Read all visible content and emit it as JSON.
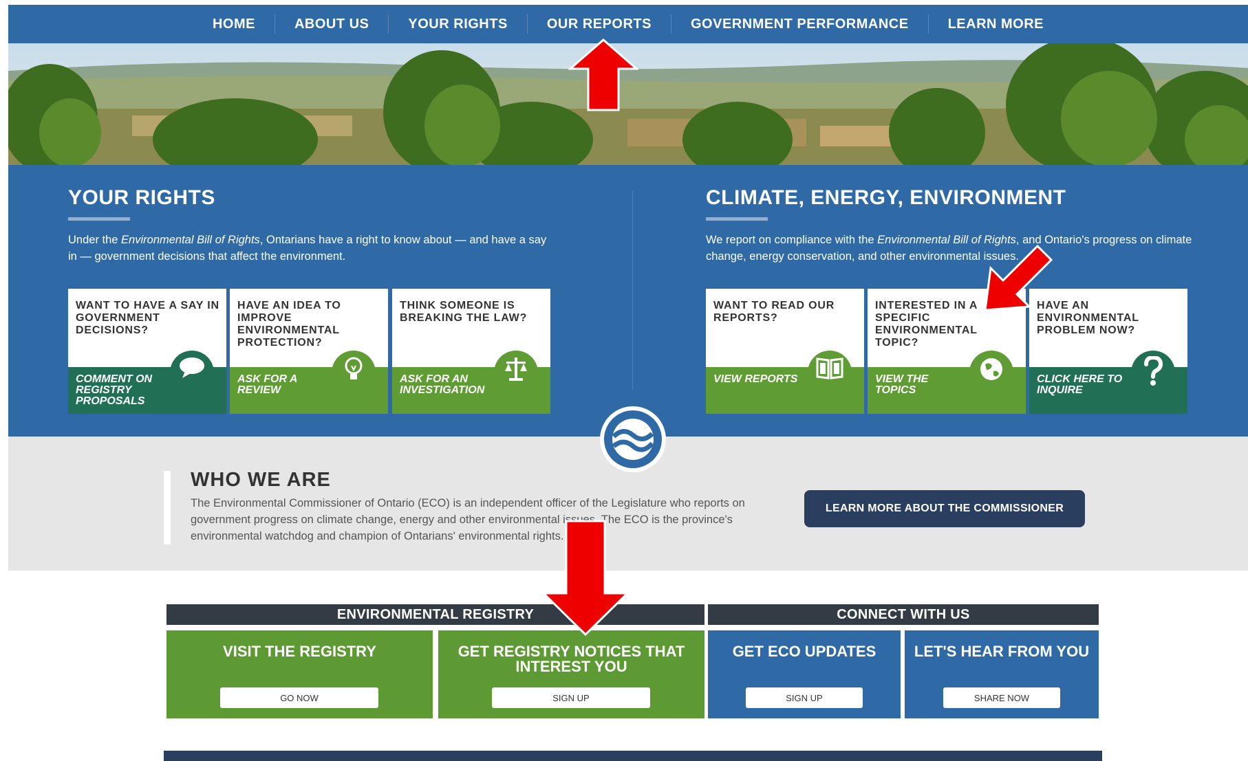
{
  "nav": {
    "items": [
      "HOME",
      "ABOUT US",
      "YOUR RIGHTS",
      "OUR REPORTS",
      "GOVERNMENT PERFORMANCE",
      "LEARN MORE"
    ]
  },
  "rights": {
    "title": "YOUR RIGHTS",
    "text_pre": "Under the ",
    "text_italic": "Environmental Bill of Rights",
    "text_post": ", Ontarians have a right to know about — and have a say in — government decisions that affect the environment.",
    "cards": [
      {
        "question": "WANT TO HAVE A SAY IN GOVERNMENT DECISIONS?",
        "link": "COMMENT ON REGISTRY PROPOSALS",
        "icon": "speech-bubble-icon"
      },
      {
        "question": "HAVE AN IDEA TO IMPROVE ENVIRONMENTAL PROTECTION?",
        "link": "ASK FOR A REVIEW",
        "icon": "lightbulb-icon"
      },
      {
        "question": "THINK SOMEONE IS BREAKING THE LAW?",
        "link": "ASK FOR AN INVESTIGATION",
        "icon": "scales-icon"
      }
    ]
  },
  "climate": {
    "title": "CLIMATE, ENERGY, ENVIRONMENT",
    "text_pre": "We report on compliance with the ",
    "text_italic": "Environmental Bill of Rights",
    "text_post": ", and Ontario's progress on climate change, energy conservation, and other environmental issues.",
    "cards": [
      {
        "question": "WANT TO READ OUR REPORTS?",
        "link": "VIEW REPORTS",
        "icon": "book-icon"
      },
      {
        "question": "INTERESTED IN A SPECIFIC ENVIRONMENTAL TOPIC?",
        "link": "VIEW THE TOPICS",
        "icon": "globe-icon"
      },
      {
        "question": "HAVE AN ENVIRONMENTAL PROBLEM NOW?",
        "link": "CLICK HERE TO INQUIRE",
        "icon": "question-mark-icon"
      }
    ]
  },
  "who": {
    "title": "WHO WE ARE",
    "text": "The Environmental Commissioner of Ontario (ECO) is an independent officer of the Legislature who reports on government progress on climate change, energy and other environmental issues. The ECO is the province's environmental watchdog and champion of Ontarians' environmental rights.",
    "button": "LEARN MORE ABOUT THE COMMISSIONER"
  },
  "registry": {
    "header": "ENVIRONMENTAL REGISTRY",
    "tiles": [
      {
        "title": "VISIT THE REGISTRY",
        "button": "GO NOW"
      },
      {
        "title": "GET REGISTRY NOTICES THAT INTEREST YOU",
        "button": "SIGN UP"
      }
    ]
  },
  "connect": {
    "header": "CONNECT WITH US",
    "tiles": [
      {
        "title": "GET ECO UPDATES",
        "button": "SIGN UP"
      },
      {
        "title": "LET'S HEAR FROM YOU",
        "button": "SHARE NOW"
      }
    ]
  },
  "colors": {
    "nav_blue": "#2f6aa6",
    "dark_green": "#217056",
    "light_green": "#5f9c34",
    "navy": "#2a3f5f",
    "annotation_red": "#ee0000"
  }
}
